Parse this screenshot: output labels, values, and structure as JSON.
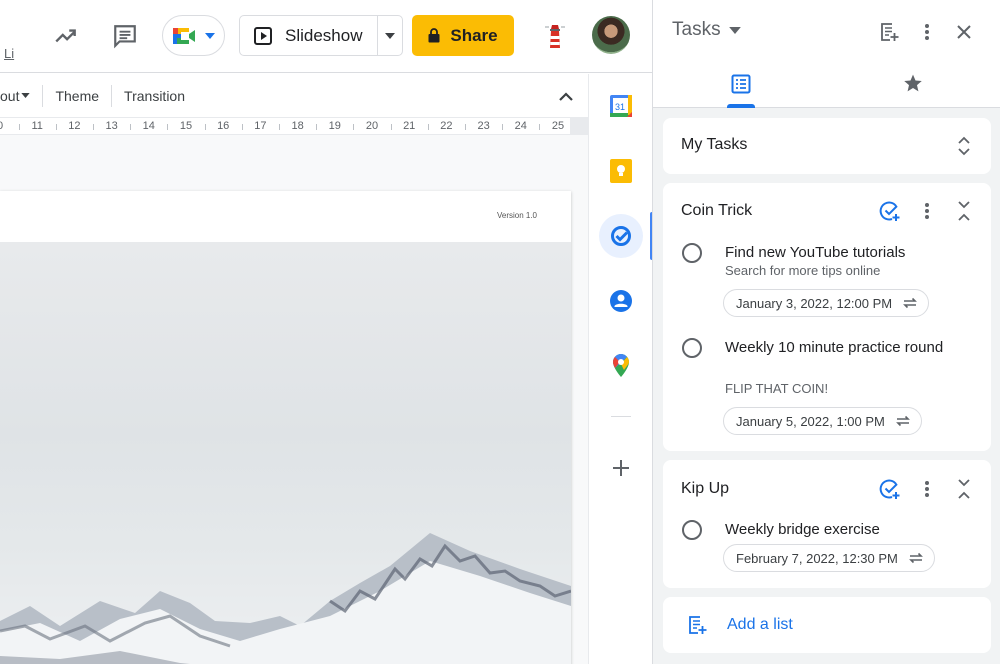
{
  "header": {
    "partial_label": "Li",
    "slideshow_label": "Slideshow",
    "share_label": "Share",
    "icons": [
      "activity-trend-icon",
      "comment-icon",
      "google-meet-icon",
      "slideshow-play-icon",
      "lock-icon",
      "lighthouse-addon-icon",
      "user-avatar"
    ]
  },
  "format_toolbar": {
    "items": [
      {
        "label": "out",
        "has_dropdown": true
      },
      {
        "label": "Theme"
      },
      {
        "label": "Transition"
      }
    ]
  },
  "ruler": {
    "labels": [
      "0",
      "11",
      "12",
      "13",
      "14",
      "15",
      "16",
      "17",
      "18",
      "19",
      "20",
      "21",
      "22",
      "23",
      "24",
      "25"
    ]
  },
  "slide": {
    "version_text": "Version 1.0"
  },
  "side_rail": {
    "items": [
      {
        "name": "calendar",
        "label": "31"
      },
      {
        "name": "keep"
      },
      {
        "name": "tasks",
        "active": true
      },
      {
        "name": "contacts"
      },
      {
        "name": "maps"
      }
    ],
    "add_label": "+"
  },
  "tasks_panel": {
    "title": "Tasks",
    "tabs": [
      "all-tasks",
      "starred"
    ],
    "my_tasks_label": "My Tasks",
    "lists": [
      {
        "title": "Coin Trick",
        "tasks": [
          {
            "title": "Find new YouTube tutorials",
            "note": "Search for more tips online",
            "date": "January 3, 2022, 12:00 PM",
            "repeats": true
          },
          {
            "title": "Weekly 10 minute practice round",
            "note": "FLIP THAT COIN!",
            "date": "January 5, 2022, 1:00 PM",
            "repeats": true
          }
        ]
      },
      {
        "title": "Kip Up",
        "tasks": [
          {
            "title": "Weekly bridge exercise",
            "note": "",
            "date": "February 7, 2022, 12:30 PM",
            "repeats": true
          }
        ]
      }
    ],
    "add_list_label": "Add a list"
  },
  "colors": {
    "accent": "#1a73e8",
    "share": "#fbbc04",
    "panel_bg": "#f1f3f4"
  }
}
